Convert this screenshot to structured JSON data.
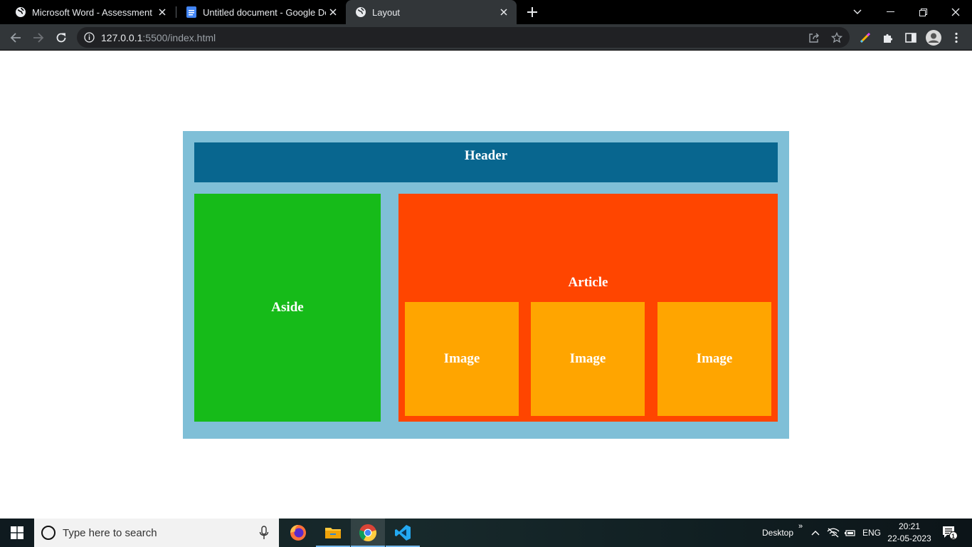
{
  "browser": {
    "tabs": [
      {
        "title": "Microsoft Word - Assessment Do",
        "icon": "globe-icon",
        "active": false
      },
      {
        "title": "Untitled document - Google Doc",
        "icon": "google-docs-icon",
        "active": false
      },
      {
        "title": "Layout",
        "icon": "globe-icon",
        "active": true
      }
    ],
    "address": {
      "host": "127.0.0.1",
      "rest": ":5500/index.html"
    }
  },
  "page": {
    "header": "Header",
    "aside": "Aside",
    "article": "Article",
    "images": [
      "Image",
      "Image",
      "Image"
    ],
    "colors": {
      "container": "#7fbfd7",
      "header": "#08668f",
      "aside": "#16bb19",
      "article": "#ff4500",
      "image": "#ffa500"
    }
  },
  "taskbar": {
    "search_placeholder": "Type here to search",
    "apps": [
      "firefox-icon",
      "file-explorer-icon",
      "chrome-icon",
      "vscode-icon"
    ],
    "desktop_label": "Desktop",
    "chevron": "»",
    "language": "ENG",
    "time": "20:21",
    "date": "22-05-2023",
    "notification_count": "1"
  }
}
